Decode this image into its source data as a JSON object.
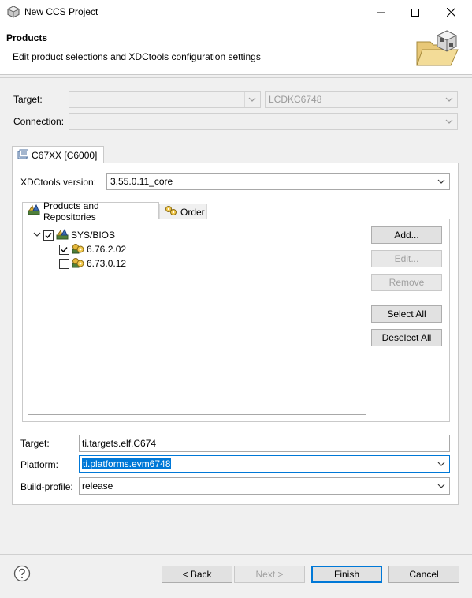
{
  "window": {
    "title": "New CCS Project"
  },
  "banner": {
    "title": "Products",
    "description": "Edit product selections and XDCtools configuration settings"
  },
  "top": {
    "target_label": "Target:",
    "target_value": "",
    "board_value": "LCDKC6748",
    "connection_label": "Connection:",
    "connection_value": ""
  },
  "device_tab": {
    "label": "C67XX [C6000]"
  },
  "xdc": {
    "label": "XDCtools version:",
    "value": "3.55.0.11_core"
  },
  "inner_tabs": {
    "products": "Products and Repositories",
    "order": "Order"
  },
  "tree": {
    "root": {
      "label": "SYS/BIOS",
      "checked": true,
      "expanded": true
    },
    "children": [
      {
        "label": "6.76.2.02",
        "checked": true
      },
      {
        "label": "6.73.0.12",
        "checked": false
      }
    ]
  },
  "side_buttons": {
    "add": "Add...",
    "edit": "Edit...",
    "remove": "Remove",
    "select_all": "Select All",
    "deselect_all": "Deselect All"
  },
  "config": {
    "target_label": "Target:",
    "target_value": "ti.targets.elf.C674",
    "platform_label": "Platform:",
    "platform_value": "ti.platforms.evm6748",
    "build_profile_label": "Build-profile:",
    "build_profile_value": "release"
  },
  "footer": {
    "back": "< Back",
    "next": "Next >",
    "finish": "Finish",
    "cancel": "Cancel"
  },
  "colors": {
    "accent": "#0078d7",
    "panel": "#f0f0f0",
    "border": "#c9c9c9"
  }
}
